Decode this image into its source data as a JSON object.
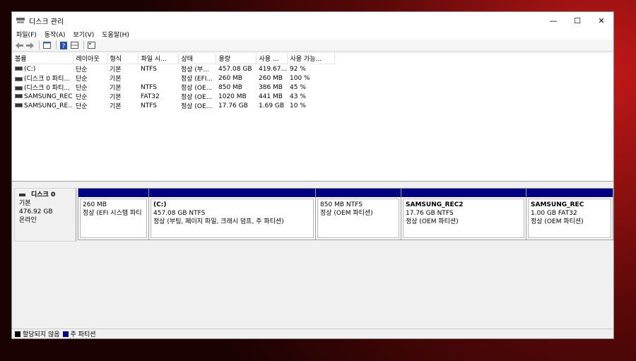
{
  "window": {
    "title": "디스크 관리",
    "controls": {
      "minimize": "—",
      "maximize": "☐",
      "close": "✕"
    }
  },
  "menu": {
    "items": [
      "파일(F)",
      "동작(A)",
      "보기(V)",
      "도움말(H)"
    ]
  },
  "toolbar": {
    "icons": [
      "back-icon",
      "forward-icon",
      "properties-icon",
      "help-icon",
      "view-icon",
      "refresh-icon"
    ]
  },
  "volume_table": {
    "headers": [
      "볼륨",
      "레이아웃",
      "형식",
      "파일 시...",
      "상태",
      "용량",
      "사용 ...",
      "사용 가능..."
    ],
    "rows": [
      [
        "(C:)",
        "단순",
        "기본",
        "NTFS",
        "정상 (부...",
        "457.08 GB",
        "419.67...",
        "92 %"
      ],
      [
        "(디스크 0 파티...",
        "단순",
        "기본",
        "",
        "정상 (EFI...",
        "260 MB",
        "260 MB",
        "100 %"
      ],
      [
        "(디스크 0 파티...",
        "단순",
        "기본",
        "NTFS",
        "정상 (OE...",
        "850 MB",
        "386 MB",
        "45 %"
      ],
      [
        "SAMSUNG_REC",
        "단순",
        "기본",
        "FAT32",
        "정상 (OE...",
        "1020 MB",
        "441 MB",
        "43 %"
      ],
      [
        "SAMSUNG_RE...",
        "단순",
        "기본",
        "NTFS",
        "정상 (OE...",
        "17.76 GB",
        "1.69 GB",
        "10 %"
      ]
    ]
  },
  "disk": {
    "name": "디스크 0",
    "type": "기본",
    "size": "476.92 GB",
    "status": "온라인",
    "partitions": [
      {
        "name": "",
        "size": "260 MB",
        "status": "정상 (EFI 시스템 파티"
      },
      {
        "name": "(C:)",
        "size": "457.08 GB NTFS",
        "status": "정상 (부팅, 페이지 파일, 크래시 덤프, 주 파티션)"
      },
      {
        "name": "",
        "size": "850 MB NTFS",
        "status": "정상 (OEM 파티션)"
      },
      {
        "name": "SAMSUNG_REC2",
        "size": "17.76 GB NTFS",
        "status": "정상 (OEM 파티션)"
      },
      {
        "name": "SAMSUNG_REC",
        "size": "1.00 GB FAT32",
        "status": "정상 (OEM 파티션)"
      }
    ]
  },
  "legend": {
    "unallocated": "할당되지 않음",
    "primary": "주 파티션",
    "unallocated_color": "#000000",
    "primary_color": "#000080"
  }
}
